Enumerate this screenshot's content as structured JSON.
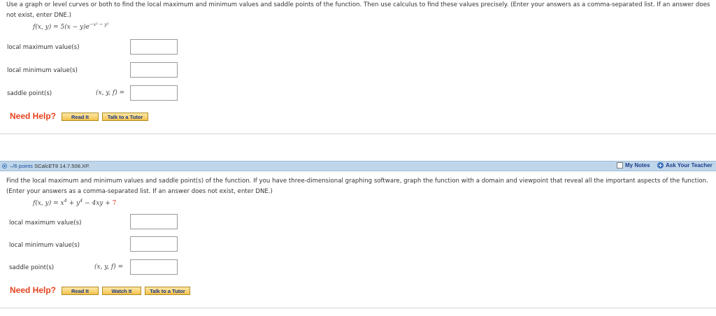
{
  "question1": {
    "prompt": "Use a graph or level curves or both to find the local maximum and minimum values and saddle points of the function. Then use calculus to find these values precisely. (Enter your answers as a comma-separated list. If an answer does not exist, enter DNE.)",
    "function_lhs": "f(x, y) = 5(x − y)e",
    "function_exp": "−x² − y²",
    "local_max_label": "local maximum value(s)",
    "local_min_label": "local minimum value(s)",
    "saddle_label": "saddle point(s)",
    "saddle_prefix": "(x, y, f) =",
    "local_max_value": "",
    "local_min_value": "",
    "saddle_value": "",
    "need_help": "Need Help?",
    "buttons": {
      "read_it": "Read It",
      "talk_to_tutor": "Talk to a Tutor"
    }
  },
  "question2": {
    "points": "–/6 points",
    "code": "SCalcET8 14.7.508.XP.",
    "my_notes": "My Notes",
    "ask_teacher": "Ask Your Teacher",
    "prompt": "Find the local maximum and minimum values and saddle point(s) of the function. If you have three-dimensional graphing software, graph the function with a domain and viewpoint that reveal all the important aspects of the function. (Enter your answers as a comma-separated list. If an answer does not exist, enter DNE.)",
    "function_lhs": "f(x, y) = x",
    "exp4": "4",
    "plus_y": " + y",
    "minus_term": " − 4xy + ",
    "const": "7",
    "local_max_label": "local maximum value(s)",
    "local_min_label": "local minimum value(s)",
    "saddle_label": "saddle point(s)",
    "saddle_prefix": "(x, y, f) =",
    "local_max_value": "",
    "local_min_value": "",
    "saddle_value": "",
    "need_help": "Need Help?",
    "buttons": {
      "read_it": "Read It",
      "watch_it": "Watch It",
      "talk_to_tutor": "Talk to a Tutor"
    }
  },
  "colors": {
    "need_help": "#e4431d",
    "bar": "#bfd6ea",
    "link": "#1a3a8a",
    "constant": "#e0342a"
  }
}
